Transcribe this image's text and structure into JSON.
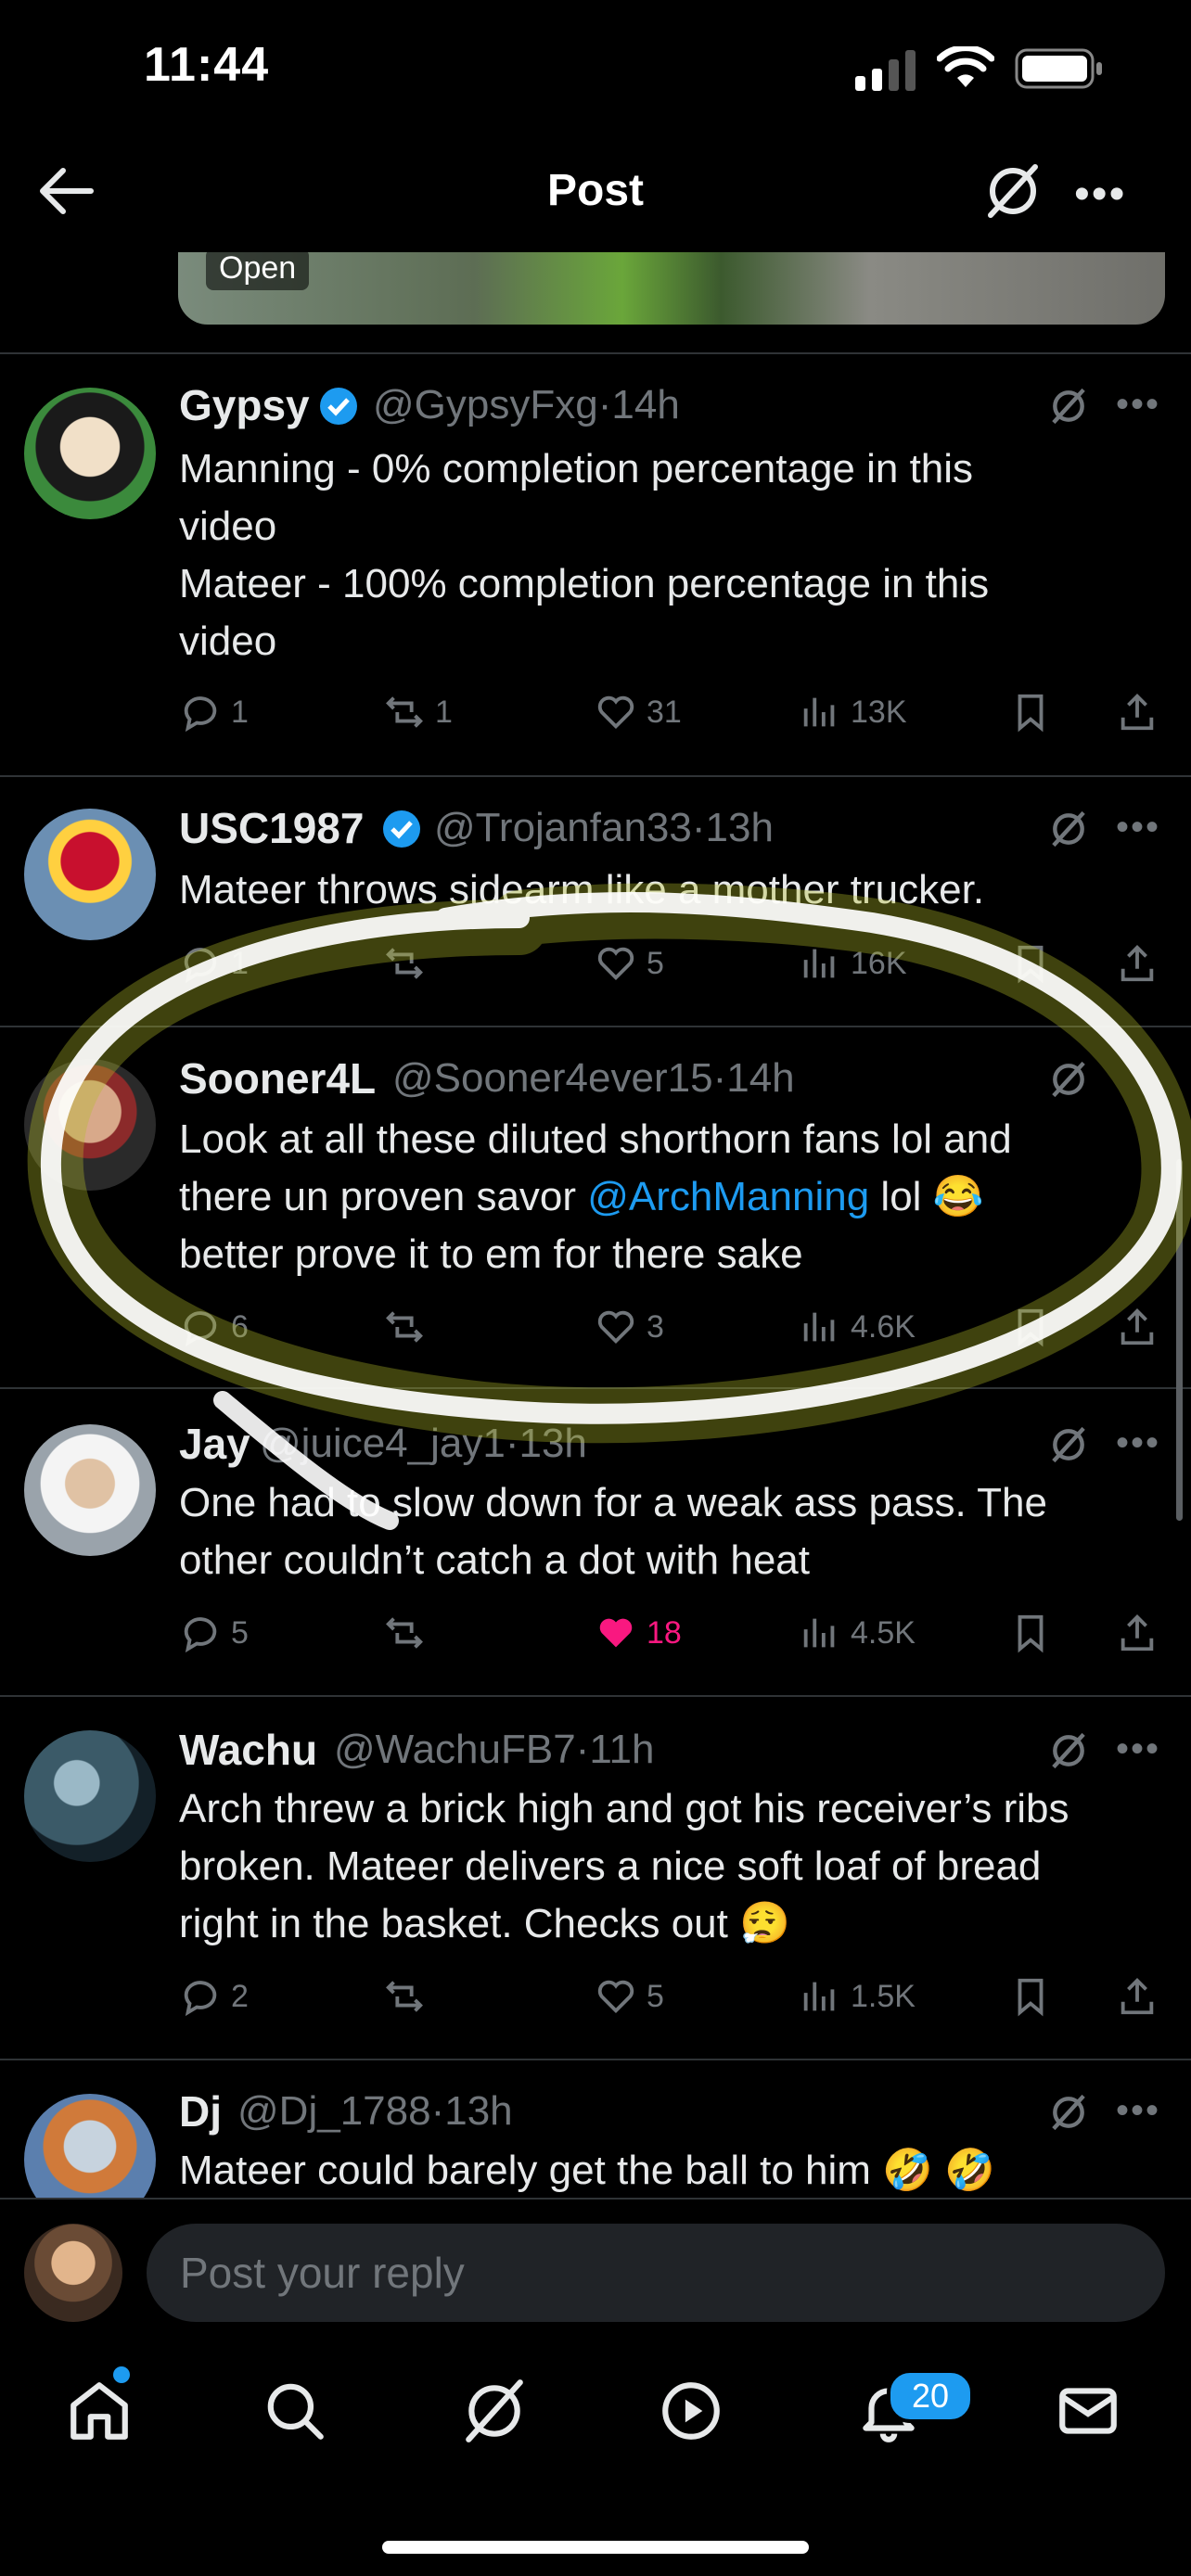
{
  "status_bar": {
    "time": "11:44"
  },
  "header": {
    "title": "Post"
  },
  "media": {
    "open_label": "Open"
  },
  "replies": [
    {
      "name": "Gypsy",
      "handle": "@GypsyFxg",
      "sep": "·",
      "time": "14h",
      "lines": [
        "Manning - 0% completion percentage  in this",
        "video",
        "Mateer - 100% completion percentage in this",
        "video"
      ],
      "replies": "1",
      "reposts": "1",
      "likes": "31",
      "views": "13K"
    },
    {
      "name": "USC1987",
      "handle": "@Trojanfan33",
      "sep": "·",
      "time": "13h",
      "lines": [
        "Mateer throws sidearm like a mother trucker."
      ],
      "replies": "1",
      "reposts": "",
      "likes": "5",
      "views": "16K"
    },
    {
      "name": "Sooner4L",
      "handle": "@Sooner4ever15",
      "sep": "·",
      "time": "14h",
      "line1": "Look at all these diluted shorthorn fans lol and",
      "line2_a": "there un proven savor ",
      "mention": "@ArchManning",
      "line2_b": " lol 😂",
      "line3": "better prove it to em for there sake",
      "replies": "6",
      "reposts": "",
      "likes": "3",
      "views": "4.6K"
    },
    {
      "name": "Jay",
      "handle": "@juice4_jay1",
      "sep": "·",
      "time": "13h",
      "lines": [
        "One had to slow down for a weak ass pass.  The",
        "other couldn’t catch a dot with heat"
      ],
      "replies": "5",
      "reposts": "",
      "likes": "18",
      "views": "4.5K"
    },
    {
      "name": "Wachu",
      "handle": "@WachuFB7",
      "sep": "·",
      "time": "11h",
      "lines": [
        "Arch threw a brick high and got his receiver’s ribs",
        "broken. Mateer delivers a nice soft loaf of bread",
        "right in the basket. Checks out 😮‍💨"
      ],
      "replies": "2",
      "reposts": "",
      "likes": "5",
      "views": "1.5K"
    },
    {
      "name": "Dj",
      "handle": "@Dj_1788",
      "sep": "·",
      "time": "13h",
      "lines": [
        "Mateer could barely get the ball to him 🤣 🤣"
      ]
    }
  ],
  "reply_box": {
    "placeholder": "Post your reply"
  },
  "tab_bar": {
    "notifications_badge": "20"
  },
  "colors": {
    "accent": "#1d9bf0",
    "like": "#f91880",
    "secondary_text": "#71767b",
    "background": "#000000"
  },
  "icons": [
    "back-arrow-icon",
    "grok-icon",
    "more-icon",
    "verified-badge-icon",
    "reply-icon",
    "repost-icon",
    "like-icon",
    "views-icon",
    "bookmark-icon",
    "share-icon",
    "home-icon",
    "search-icon",
    "play-icon",
    "bell-icon",
    "mail-icon"
  ]
}
